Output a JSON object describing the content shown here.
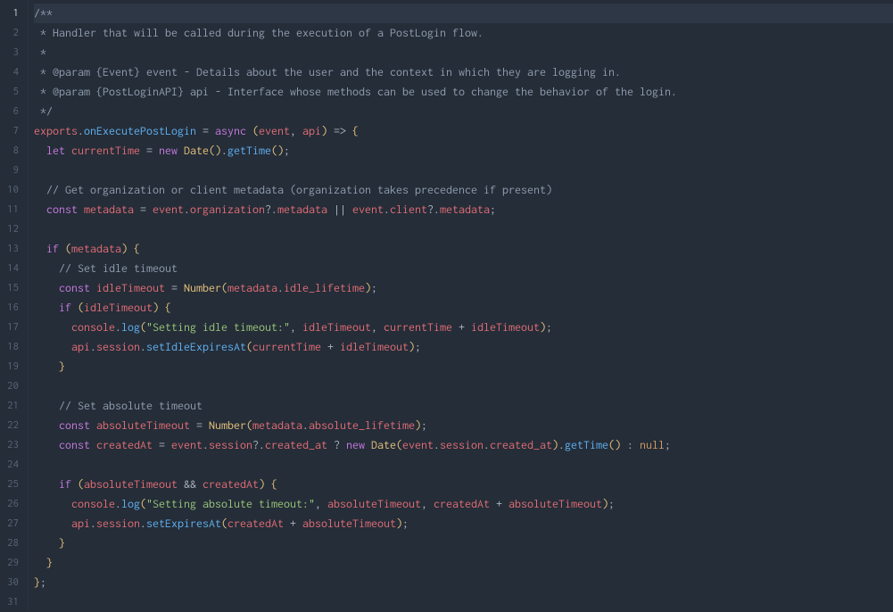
{
  "editor": {
    "highlighted_line": 1,
    "line_count": 31,
    "lines": [
      [
        {
          "cls": "tk-comment",
          "text": "/**"
        }
      ],
      [
        {
          "cls": "tk-comment",
          "text": " * Handler that will be called during the execution of a PostLogin flow."
        }
      ],
      [
        {
          "cls": "tk-comment",
          "text": " *"
        }
      ],
      [
        {
          "cls": "tk-comment",
          "text": " * @param {Event} event - Details about the user and the context in which they are logging in."
        }
      ],
      [
        {
          "cls": "tk-comment",
          "text": " * @param {PostLoginAPI} api - Interface whose methods can be used to change the behavior of the login."
        }
      ],
      [
        {
          "cls": "tk-comment",
          "text": " */"
        }
      ],
      [
        {
          "cls": "tk-ident",
          "text": "exports"
        },
        {
          "cls": "tk-punct",
          "text": "."
        },
        {
          "cls": "tk-func",
          "text": "onExecutePostLogin"
        },
        {
          "cls": "tk-plain",
          "text": " "
        },
        {
          "cls": "tk-punct",
          "text": "="
        },
        {
          "cls": "tk-plain",
          "text": " "
        },
        {
          "cls": "tk-kw",
          "text": "async"
        },
        {
          "cls": "tk-plain",
          "text": " "
        },
        {
          "cls": "tk-paren",
          "text": "("
        },
        {
          "cls": "tk-ident",
          "text": "event"
        },
        {
          "cls": "tk-punct",
          "text": ", "
        },
        {
          "cls": "tk-ident",
          "text": "api"
        },
        {
          "cls": "tk-paren",
          "text": ")"
        },
        {
          "cls": "tk-plain",
          "text": " "
        },
        {
          "cls": "tk-punct",
          "text": "=>"
        },
        {
          "cls": "tk-plain",
          "text": " "
        },
        {
          "cls": "tk-brace",
          "text": "{"
        }
      ],
      [
        {
          "cls": "tk-plain",
          "text": "  "
        },
        {
          "cls": "tk-kw",
          "text": "let"
        },
        {
          "cls": "tk-plain",
          "text": " "
        },
        {
          "cls": "tk-ident",
          "text": "currentTime"
        },
        {
          "cls": "tk-plain",
          "text": " "
        },
        {
          "cls": "tk-punct",
          "text": "="
        },
        {
          "cls": "tk-plain",
          "text": " "
        },
        {
          "cls": "tk-kw",
          "text": "new"
        },
        {
          "cls": "tk-plain",
          "text": " "
        },
        {
          "cls": "tk-type",
          "text": "Date"
        },
        {
          "cls": "tk-paren",
          "text": "()"
        },
        {
          "cls": "tk-punct",
          "text": "."
        },
        {
          "cls": "tk-func",
          "text": "getTime"
        },
        {
          "cls": "tk-paren",
          "text": "()"
        },
        {
          "cls": "tk-punct",
          "text": ";"
        }
      ],
      [],
      [
        {
          "cls": "tk-plain",
          "text": "  "
        },
        {
          "cls": "tk-comment",
          "text": "// Get organization or client metadata (organization takes precedence if present)"
        }
      ],
      [
        {
          "cls": "tk-plain",
          "text": "  "
        },
        {
          "cls": "tk-kw",
          "text": "const"
        },
        {
          "cls": "tk-plain",
          "text": " "
        },
        {
          "cls": "tk-ident",
          "text": "metadata"
        },
        {
          "cls": "tk-plain",
          "text": " "
        },
        {
          "cls": "tk-punct",
          "text": "="
        },
        {
          "cls": "tk-plain",
          "text": " "
        },
        {
          "cls": "tk-ident",
          "text": "event"
        },
        {
          "cls": "tk-punct",
          "text": "."
        },
        {
          "cls": "tk-ident",
          "text": "organization"
        },
        {
          "cls": "tk-punct",
          "text": "?"
        },
        {
          "cls": "tk-punct",
          "text": "."
        },
        {
          "cls": "tk-ident",
          "text": "metadata"
        },
        {
          "cls": "tk-plain",
          "text": " "
        },
        {
          "cls": "tk-punct",
          "text": "||"
        },
        {
          "cls": "tk-plain",
          "text": " "
        },
        {
          "cls": "tk-ident",
          "text": "event"
        },
        {
          "cls": "tk-punct",
          "text": "."
        },
        {
          "cls": "tk-ident",
          "text": "client"
        },
        {
          "cls": "tk-punct",
          "text": "?"
        },
        {
          "cls": "tk-punct",
          "text": "."
        },
        {
          "cls": "tk-ident",
          "text": "metadata"
        },
        {
          "cls": "tk-punct",
          "text": ";"
        }
      ],
      [],
      [
        {
          "cls": "tk-plain",
          "text": "  "
        },
        {
          "cls": "tk-kw",
          "text": "if"
        },
        {
          "cls": "tk-plain",
          "text": " "
        },
        {
          "cls": "tk-paren",
          "text": "("
        },
        {
          "cls": "tk-ident",
          "text": "metadata"
        },
        {
          "cls": "tk-paren",
          "text": ")"
        },
        {
          "cls": "tk-plain",
          "text": " "
        },
        {
          "cls": "tk-brace",
          "text": "{"
        }
      ],
      [
        {
          "cls": "tk-plain",
          "text": "    "
        },
        {
          "cls": "tk-comment",
          "text": "// Set idle timeout"
        }
      ],
      [
        {
          "cls": "tk-plain",
          "text": "    "
        },
        {
          "cls": "tk-kw",
          "text": "const"
        },
        {
          "cls": "tk-plain",
          "text": " "
        },
        {
          "cls": "tk-ident",
          "text": "idleTimeout"
        },
        {
          "cls": "tk-plain",
          "text": " "
        },
        {
          "cls": "tk-punct",
          "text": "="
        },
        {
          "cls": "tk-plain",
          "text": " "
        },
        {
          "cls": "tk-type",
          "text": "Number"
        },
        {
          "cls": "tk-paren",
          "text": "("
        },
        {
          "cls": "tk-ident",
          "text": "metadata"
        },
        {
          "cls": "tk-punct",
          "text": "."
        },
        {
          "cls": "tk-ident",
          "text": "idle_lifetime"
        },
        {
          "cls": "tk-paren",
          "text": ")"
        },
        {
          "cls": "tk-punct",
          "text": ";"
        }
      ],
      [
        {
          "cls": "tk-plain",
          "text": "    "
        },
        {
          "cls": "tk-kw",
          "text": "if"
        },
        {
          "cls": "tk-plain",
          "text": " "
        },
        {
          "cls": "tk-paren",
          "text": "("
        },
        {
          "cls": "tk-ident",
          "text": "idleTimeout"
        },
        {
          "cls": "tk-paren",
          "text": ")"
        },
        {
          "cls": "tk-plain",
          "text": " "
        },
        {
          "cls": "tk-brace",
          "text": "{"
        }
      ],
      [
        {
          "cls": "tk-plain",
          "text": "      "
        },
        {
          "cls": "tk-ident",
          "text": "console"
        },
        {
          "cls": "tk-punct",
          "text": "."
        },
        {
          "cls": "tk-func",
          "text": "log"
        },
        {
          "cls": "tk-paren",
          "text": "("
        },
        {
          "cls": "tk-str",
          "text": "\"Setting idle timeout:\""
        },
        {
          "cls": "tk-punct",
          "text": ", "
        },
        {
          "cls": "tk-ident",
          "text": "idleTimeout"
        },
        {
          "cls": "tk-punct",
          "text": ", "
        },
        {
          "cls": "tk-ident",
          "text": "currentTime"
        },
        {
          "cls": "tk-plain",
          "text": " "
        },
        {
          "cls": "tk-punct",
          "text": "+"
        },
        {
          "cls": "tk-plain",
          "text": " "
        },
        {
          "cls": "tk-ident",
          "text": "idleTimeout"
        },
        {
          "cls": "tk-paren",
          "text": ")"
        },
        {
          "cls": "tk-punct",
          "text": ";"
        }
      ],
      [
        {
          "cls": "tk-plain",
          "text": "      "
        },
        {
          "cls": "tk-ident",
          "text": "api"
        },
        {
          "cls": "tk-punct",
          "text": "."
        },
        {
          "cls": "tk-ident",
          "text": "session"
        },
        {
          "cls": "tk-punct",
          "text": "."
        },
        {
          "cls": "tk-func",
          "text": "setIdleExpiresAt"
        },
        {
          "cls": "tk-paren",
          "text": "("
        },
        {
          "cls": "tk-ident",
          "text": "currentTime"
        },
        {
          "cls": "tk-plain",
          "text": " "
        },
        {
          "cls": "tk-punct",
          "text": "+"
        },
        {
          "cls": "tk-plain",
          "text": " "
        },
        {
          "cls": "tk-ident",
          "text": "idleTimeout"
        },
        {
          "cls": "tk-paren",
          "text": ")"
        },
        {
          "cls": "tk-punct",
          "text": ";"
        }
      ],
      [
        {
          "cls": "tk-plain",
          "text": "    "
        },
        {
          "cls": "tk-brace",
          "text": "}"
        }
      ],
      [],
      [
        {
          "cls": "tk-plain",
          "text": "    "
        },
        {
          "cls": "tk-comment",
          "text": "// Set absolute timeout"
        }
      ],
      [
        {
          "cls": "tk-plain",
          "text": "    "
        },
        {
          "cls": "tk-kw",
          "text": "const"
        },
        {
          "cls": "tk-plain",
          "text": " "
        },
        {
          "cls": "tk-ident",
          "text": "absoluteTimeout"
        },
        {
          "cls": "tk-plain",
          "text": " "
        },
        {
          "cls": "tk-punct",
          "text": "="
        },
        {
          "cls": "tk-plain",
          "text": " "
        },
        {
          "cls": "tk-type",
          "text": "Number"
        },
        {
          "cls": "tk-paren",
          "text": "("
        },
        {
          "cls": "tk-ident",
          "text": "metadata"
        },
        {
          "cls": "tk-punct",
          "text": "."
        },
        {
          "cls": "tk-ident",
          "text": "absolute_lifetime"
        },
        {
          "cls": "tk-paren",
          "text": ")"
        },
        {
          "cls": "tk-punct",
          "text": ";"
        }
      ],
      [
        {
          "cls": "tk-plain",
          "text": "    "
        },
        {
          "cls": "tk-kw",
          "text": "const"
        },
        {
          "cls": "tk-plain",
          "text": " "
        },
        {
          "cls": "tk-ident",
          "text": "createdAt"
        },
        {
          "cls": "tk-plain",
          "text": " "
        },
        {
          "cls": "tk-punct",
          "text": "="
        },
        {
          "cls": "tk-plain",
          "text": " "
        },
        {
          "cls": "tk-ident",
          "text": "event"
        },
        {
          "cls": "tk-punct",
          "text": "."
        },
        {
          "cls": "tk-ident",
          "text": "session"
        },
        {
          "cls": "tk-punct",
          "text": "?"
        },
        {
          "cls": "tk-punct",
          "text": "."
        },
        {
          "cls": "tk-ident",
          "text": "created_at"
        },
        {
          "cls": "tk-plain",
          "text": " "
        },
        {
          "cls": "tk-punct",
          "text": "?"
        },
        {
          "cls": "tk-plain",
          "text": " "
        },
        {
          "cls": "tk-kw",
          "text": "new"
        },
        {
          "cls": "tk-plain",
          "text": " "
        },
        {
          "cls": "tk-type",
          "text": "Date"
        },
        {
          "cls": "tk-paren",
          "text": "("
        },
        {
          "cls": "tk-ident",
          "text": "event"
        },
        {
          "cls": "tk-punct",
          "text": "."
        },
        {
          "cls": "tk-ident",
          "text": "session"
        },
        {
          "cls": "tk-punct",
          "text": "."
        },
        {
          "cls": "tk-ident",
          "text": "created_at"
        },
        {
          "cls": "tk-paren",
          "text": ")"
        },
        {
          "cls": "tk-punct",
          "text": "."
        },
        {
          "cls": "tk-func",
          "text": "getTime"
        },
        {
          "cls": "tk-paren",
          "text": "()"
        },
        {
          "cls": "tk-plain",
          "text": " "
        },
        {
          "cls": "tk-punct",
          "text": ":"
        },
        {
          "cls": "tk-plain",
          "text": " "
        },
        {
          "cls": "tk-num",
          "text": "null"
        },
        {
          "cls": "tk-punct",
          "text": ";"
        }
      ],
      [],
      [
        {
          "cls": "tk-plain",
          "text": "    "
        },
        {
          "cls": "tk-kw",
          "text": "if"
        },
        {
          "cls": "tk-plain",
          "text": " "
        },
        {
          "cls": "tk-paren",
          "text": "("
        },
        {
          "cls": "tk-ident",
          "text": "absoluteTimeout"
        },
        {
          "cls": "tk-plain",
          "text": " "
        },
        {
          "cls": "tk-punct",
          "text": "&&"
        },
        {
          "cls": "tk-plain",
          "text": " "
        },
        {
          "cls": "tk-ident",
          "text": "createdAt"
        },
        {
          "cls": "tk-paren",
          "text": ")"
        },
        {
          "cls": "tk-plain",
          "text": " "
        },
        {
          "cls": "tk-brace",
          "text": "{"
        }
      ],
      [
        {
          "cls": "tk-plain",
          "text": "      "
        },
        {
          "cls": "tk-ident",
          "text": "console"
        },
        {
          "cls": "tk-punct",
          "text": "."
        },
        {
          "cls": "tk-func",
          "text": "log"
        },
        {
          "cls": "tk-paren",
          "text": "("
        },
        {
          "cls": "tk-str",
          "text": "\"Setting absolute timeout:\""
        },
        {
          "cls": "tk-punct",
          "text": ", "
        },
        {
          "cls": "tk-ident",
          "text": "absoluteTimeout"
        },
        {
          "cls": "tk-punct",
          "text": ", "
        },
        {
          "cls": "tk-ident",
          "text": "createdAt"
        },
        {
          "cls": "tk-plain",
          "text": " "
        },
        {
          "cls": "tk-punct",
          "text": "+"
        },
        {
          "cls": "tk-plain",
          "text": " "
        },
        {
          "cls": "tk-ident",
          "text": "absoluteTimeout"
        },
        {
          "cls": "tk-paren",
          "text": ")"
        },
        {
          "cls": "tk-punct",
          "text": ";"
        }
      ],
      [
        {
          "cls": "tk-plain",
          "text": "      "
        },
        {
          "cls": "tk-ident",
          "text": "api"
        },
        {
          "cls": "tk-punct",
          "text": "."
        },
        {
          "cls": "tk-ident",
          "text": "session"
        },
        {
          "cls": "tk-punct",
          "text": "."
        },
        {
          "cls": "tk-func",
          "text": "setExpiresAt"
        },
        {
          "cls": "tk-paren",
          "text": "("
        },
        {
          "cls": "tk-ident",
          "text": "createdAt"
        },
        {
          "cls": "tk-plain",
          "text": " "
        },
        {
          "cls": "tk-punct",
          "text": "+"
        },
        {
          "cls": "tk-plain",
          "text": " "
        },
        {
          "cls": "tk-ident",
          "text": "absoluteTimeout"
        },
        {
          "cls": "tk-paren",
          "text": ")"
        },
        {
          "cls": "tk-punct",
          "text": ";"
        }
      ],
      [
        {
          "cls": "tk-plain",
          "text": "    "
        },
        {
          "cls": "tk-brace",
          "text": "}"
        }
      ],
      [
        {
          "cls": "tk-plain",
          "text": "  "
        },
        {
          "cls": "tk-brace",
          "text": "}"
        }
      ],
      [
        {
          "cls": "tk-brace",
          "text": "}"
        },
        {
          "cls": "tk-punct",
          "text": ";"
        }
      ],
      []
    ]
  }
}
